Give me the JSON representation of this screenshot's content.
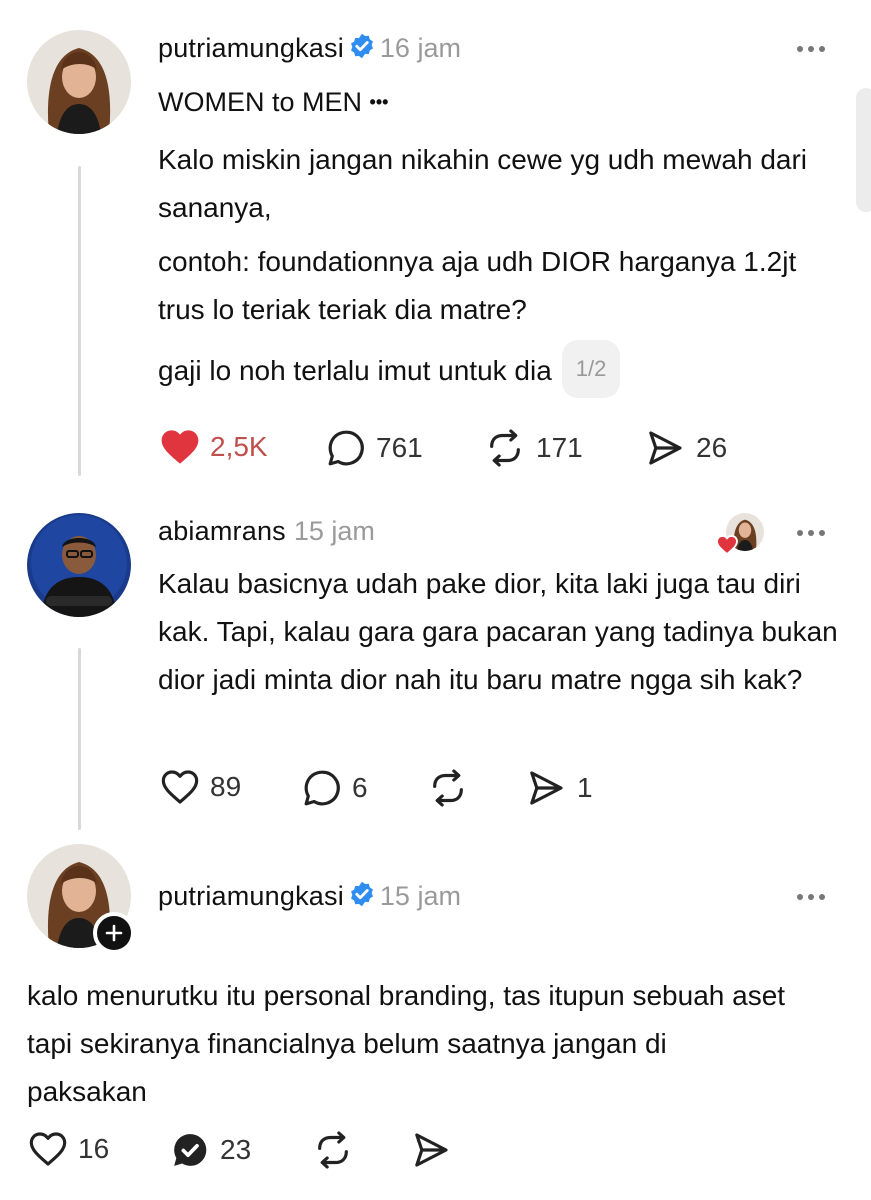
{
  "posts": [
    {
      "username": "putriamungkasi",
      "verified": true,
      "time": "16 jam",
      "title": "WOMEN to MEN",
      "title_suffix": "•••",
      "paragraphs": [
        "Kalo miskin jangan nikahin cewe yg udh mewah dari sananya,",
        "contoh: foundationnya aja udh DIOR harganya 1.2jt trus lo teriak teriak dia matre?",
        "gaji lo noh terlalu imut untuk dia"
      ],
      "page_indicator": "1/2",
      "likes": "2,5K",
      "liked": true,
      "comments": "761",
      "reposts": "171",
      "shares": "26"
    },
    {
      "username": "abiamrans",
      "time": "15 jam",
      "text": "Kalau basicnya udah pake dior, kita laki juga tau diri kak. Tapi, kalau gara gara pacaran yang tadinya bukan dior jadi minta dior nah itu baru matre ngga sih kak?",
      "likes": "89",
      "comments": "6",
      "reposts": "",
      "shares": "1"
    },
    {
      "username": "putriamungkasi",
      "verified": true,
      "time": "15 jam",
      "text": "kalo menurutku itu personal branding, tas itupun sebuah aset tapi sekiranya financialnya belum saatnya jangan di paksakan",
      "likes": "16",
      "comments": "23",
      "reposts": "",
      "shares": ""
    }
  ],
  "colors": {
    "like_red": "#e0343f",
    "verified_blue": "#2f8cf0",
    "muted": "#9a9a9a"
  }
}
